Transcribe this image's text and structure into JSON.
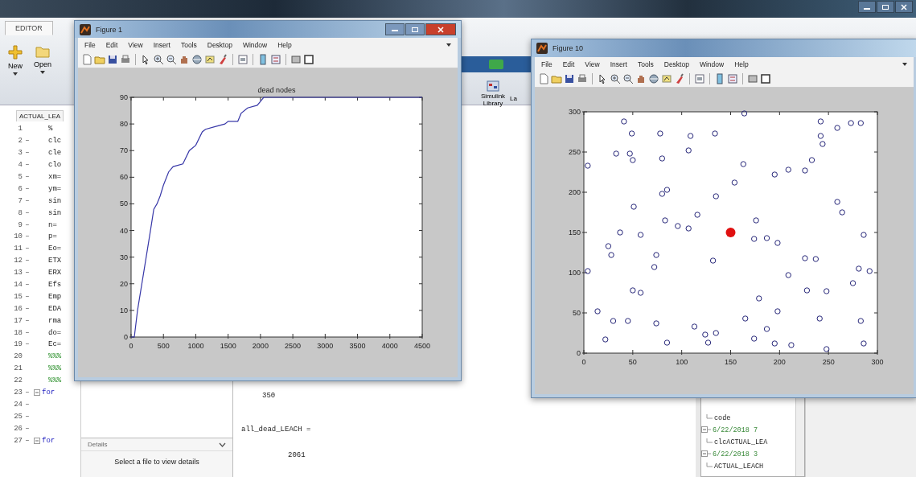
{
  "toolstrip": {
    "tabs": [
      {
        "label": "EDITOR",
        "selected": true
      }
    ],
    "buttons": [
      {
        "kind": "new",
        "label": "New"
      },
      {
        "kind": "open",
        "label": "Open"
      }
    ],
    "library_button": "Simulink Library",
    "cut_button": "La"
  },
  "editor": {
    "file_tab": "ACTUAL_LEA",
    "lines": [
      {
        "number": "1",
        "code": "%"
      },
      {
        "number": "2",
        "marker": "–",
        "code": "clc"
      },
      {
        "number": "3",
        "marker": "–",
        "code": "cle"
      },
      {
        "number": "4",
        "marker": "–",
        "code": "clo"
      },
      {
        "number": "5",
        "marker": "–",
        "code": "xm="
      },
      {
        "number": "6",
        "marker": "–",
        "code": "ym="
      },
      {
        "number": "7",
        "marker": "–",
        "code": "sin"
      },
      {
        "number": "8",
        "marker": "–",
        "code": "sin"
      },
      {
        "number": "9",
        "marker": "–",
        "code": "n="
      },
      {
        "number": "10",
        "marker": "–",
        "code": "p="
      },
      {
        "number": "11",
        "marker": "–",
        "code": "Eo="
      },
      {
        "number": "12",
        "marker": "–",
        "code": "ETX"
      },
      {
        "number": "13",
        "marker": "–",
        "code": "ERX"
      },
      {
        "number": "14",
        "marker": "–",
        "code": "Efs"
      },
      {
        "number": "15",
        "marker": "–",
        "code": "Emp"
      },
      {
        "number": "16",
        "marker": "–",
        "code": "EDA"
      },
      {
        "number": "17",
        "marker": "–",
        "code": "rma"
      },
      {
        "number": "18",
        "marker": "–",
        "code": "do="
      },
      {
        "number": "19",
        "marker": "–",
        "code": "Ec="
      },
      {
        "number": "20",
        "kind": "comment",
        "code": "%%%"
      },
      {
        "number": "21",
        "kind": "comment",
        "code": "%%%"
      },
      {
        "number": "22",
        "kind": "comment",
        "code": "%%%"
      },
      {
        "number": "23",
        "marker": "–",
        "kind": "keyword",
        "fold": true,
        "code": "for"
      },
      {
        "number": "24",
        "marker": "–"
      },
      {
        "number": "25",
        "marker": "–"
      },
      {
        "number": "26",
        "marker": "–"
      },
      {
        "number": "27",
        "marker": "–",
        "kind": "keyword",
        "fold": true,
        "code": "for"
      }
    ]
  },
  "details": {
    "title": "Details",
    "message": "Select a file to view details"
  },
  "command_window": {
    "lines": [
      {
        "kind": "output",
        "text": "350"
      },
      {
        "kind": "assignment",
        "text": "all_dead_LEACH ="
      },
      {
        "kind": "output",
        "text": "2061"
      }
    ]
  },
  "history": {
    "items": [
      {
        "kind": "command",
        "text": "code"
      },
      {
        "kind": "session",
        "text": "6/22/2018 7"
      },
      {
        "kind": "command",
        "text": "clcACTUAL_LEA"
      },
      {
        "kind": "session",
        "text": "6/22/2018 3"
      },
      {
        "kind": "command",
        "text": "ACTUAL_LEACH"
      }
    ]
  },
  "figures": [
    {
      "title": "Figure 1",
      "menu": [
        "File",
        "Edit",
        "View",
        "Insert",
        "Tools",
        "Desktop",
        "Window",
        "Help"
      ],
      "chart_data": {
        "type": "line",
        "title": "dead nodes",
        "x": [
          0,
          50,
          100,
          200,
          300,
          350,
          400,
          450,
          500,
          580,
          650,
          800,
          900,
          1000,
          1100,
          1150,
          1300,
          1450,
          1500,
          1650,
          1700,
          1800,
          1950,
          2050,
          4500
        ],
        "series": [
          {
            "color": "#3838a8",
            "values": [
              0,
              0,
              10,
              25,
              40,
              48,
              50,
              53,
              57,
              62,
              64,
              65,
              70,
              72,
              77,
              78,
              79,
              80,
              81,
              81,
              84,
              86,
              87,
              90,
              90
            ]
          }
        ],
        "xlim": [
          0,
          4500
        ],
        "ylim": [
          0,
          90
        ],
        "xticks": [
          0,
          500,
          1000,
          1500,
          2000,
          2500,
          3000,
          3500,
          4000,
          4500
        ],
        "yticks": [
          0,
          10,
          20,
          30,
          40,
          50,
          60,
          70,
          80,
          90
        ]
      }
    },
    {
      "title": "Figure 10",
      "menu": [
        "File",
        "Edit",
        "View",
        "Insert",
        "Tools",
        "Desktop",
        "Window",
        "Help"
      ],
      "chart_data": {
        "type": "scatter",
        "series": [
          {
            "color": "#28287a",
            "x": [
              41,
              49,
              78,
              109,
              134,
              164,
              242,
              259,
              273,
              283,
              242,
              244,
              33,
              47,
              107,
              80,
              50,
              4,
              163,
              233,
              195,
              209,
              226,
              154,
              85,
              80,
              135,
              259,
              264,
              51,
              116,
              83,
              96,
              107,
              176,
              37,
              58,
              286,
              174,
              187,
              198,
              25,
              28,
              74,
              132,
              226,
              237,
              72,
              4,
              281,
              292,
              209,
              275,
              50,
              58,
              228,
              248,
              179,
              14,
              198,
              30,
              45,
              74,
              165,
              241,
              283,
              113,
              187,
              124,
              135,
              174,
              22,
              85,
              127,
              195,
              212,
              248,
              286
            ],
            "values": [
              288,
              273,
              273,
              270,
              273,
              298,
              288,
              280,
              286,
              286,
              270,
              260,
              248,
              248,
              252,
              242,
              240,
              233,
              235,
              240,
              222,
              228,
              227,
              212,
              203,
              198,
              195,
              188,
              175,
              182,
              172,
              165,
              158,
              155,
              165,
              150,
              147,
              147,
              142,
              143,
              137,
              133,
              122,
              122,
              115,
              118,
              117,
              107,
              102,
              105,
              102,
              97,
              87,
              78,
              75,
              78,
              77,
              68,
              52,
              52,
              40,
              40,
              37,
              43,
              43,
              40,
              33,
              30,
              23,
              25,
              18,
              17,
              13,
              13,
              12,
              10,
              5,
              12
            ]
          },
          {
            "color": "#e01010",
            "x": [
              150
            ],
            "values": [
              150
            ]
          }
        ],
        "xlim": [
          0,
          300
        ],
        "ylim": [
          0,
          300
        ],
        "xticks": [
          0,
          50,
          100,
          150,
          200,
          250,
          300
        ],
        "yticks": [
          0,
          50,
          100,
          150,
          200,
          250,
          300
        ]
      }
    }
  ]
}
